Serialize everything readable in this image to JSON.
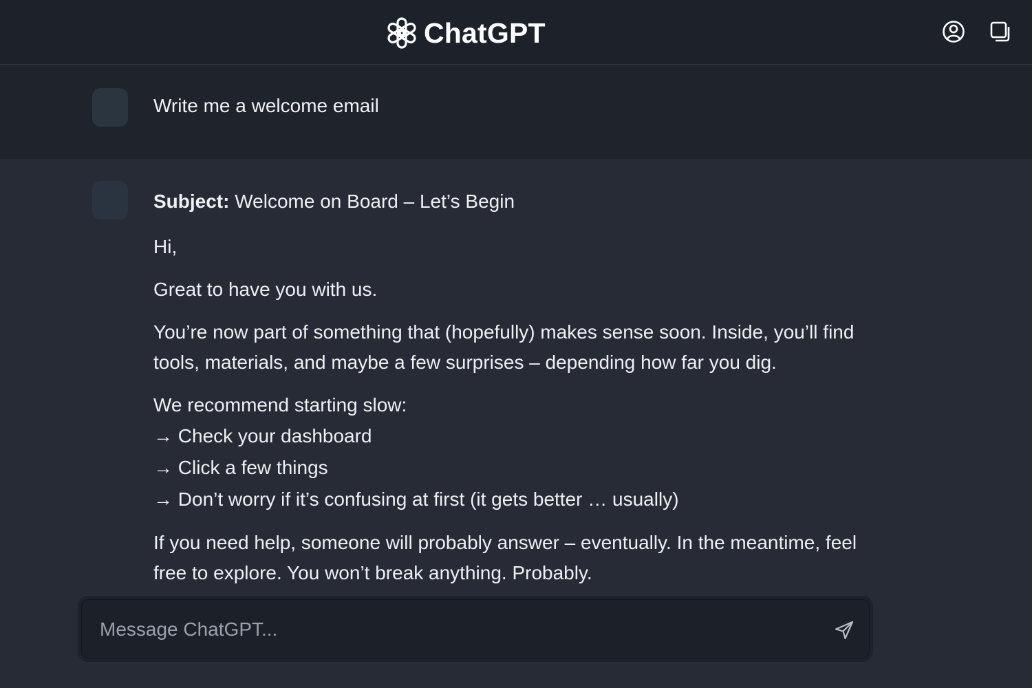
{
  "header": {
    "title": "ChatGPT",
    "logo_icon": "openai-logo-icon",
    "profile_icon": "user-circle-icon",
    "new_chat_icon": "new-chat-icon"
  },
  "conversation": {
    "user_message": "Write me a welcome email",
    "assistant_message": {
      "subject_label": "Subject:",
      "subject_text": "Welcome on Board – Let’s Begin",
      "greeting": "Hi,",
      "paragraph_1": "Great to have you with us.",
      "paragraph_2": "You’re now part of something that (hopefully) makes sense soon. Inside, you’ll find tools, materials, and maybe a few surprises – depending how far you dig.",
      "list_intro": "We recommend starting slow:",
      "list_items": [
        "→ Check your dashboard",
        "→ Click a few things",
        "→ Don’t worry if it’s confusing at first (it gets better … usually)"
      ],
      "paragraph_3": "If you need help, someone will probably answer – eventually. In the meantime, feel free to explore. You won’t break anything. Probably."
    }
  },
  "composer": {
    "placeholder": "Message ChatGPT...",
    "value": "",
    "send_icon": "send-icon"
  },
  "colors": {
    "background": "#232833",
    "header": "#1d212a",
    "user_row": "#1f232c",
    "assistant_row": "#262b36",
    "text": "#eef0f3",
    "placeholder": "#9ba1ab"
  }
}
